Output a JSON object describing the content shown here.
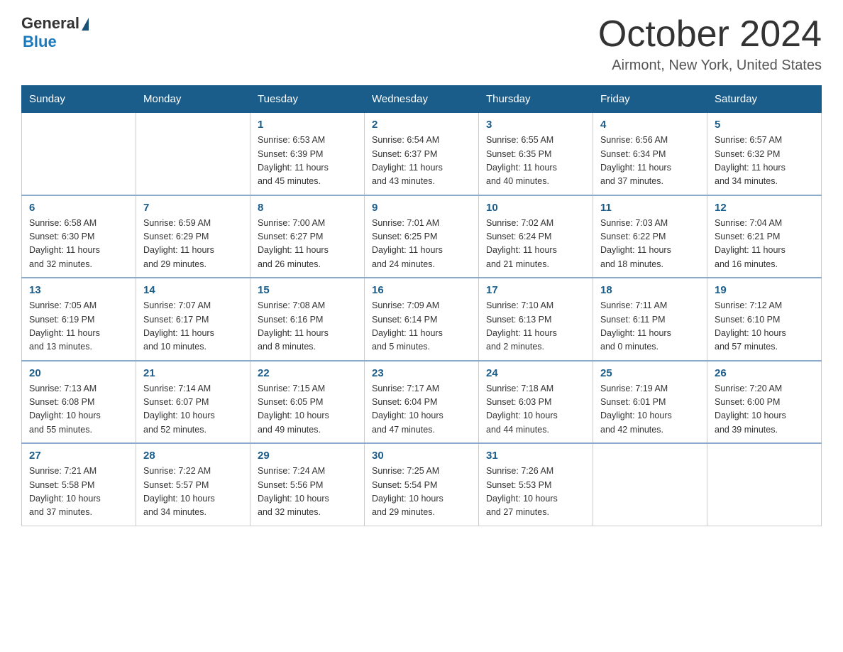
{
  "header": {
    "logo_general": "General",
    "logo_blue": "Blue",
    "month_title": "October 2024",
    "location": "Airmont, New York, United States"
  },
  "weekdays": [
    "Sunday",
    "Monday",
    "Tuesday",
    "Wednesday",
    "Thursday",
    "Friday",
    "Saturday"
  ],
  "weeks": [
    [
      {
        "day": "",
        "info": ""
      },
      {
        "day": "",
        "info": ""
      },
      {
        "day": "1",
        "info": "Sunrise: 6:53 AM\nSunset: 6:39 PM\nDaylight: 11 hours\nand 45 minutes."
      },
      {
        "day": "2",
        "info": "Sunrise: 6:54 AM\nSunset: 6:37 PM\nDaylight: 11 hours\nand 43 minutes."
      },
      {
        "day": "3",
        "info": "Sunrise: 6:55 AM\nSunset: 6:35 PM\nDaylight: 11 hours\nand 40 minutes."
      },
      {
        "day": "4",
        "info": "Sunrise: 6:56 AM\nSunset: 6:34 PM\nDaylight: 11 hours\nand 37 minutes."
      },
      {
        "day": "5",
        "info": "Sunrise: 6:57 AM\nSunset: 6:32 PM\nDaylight: 11 hours\nand 34 minutes."
      }
    ],
    [
      {
        "day": "6",
        "info": "Sunrise: 6:58 AM\nSunset: 6:30 PM\nDaylight: 11 hours\nand 32 minutes."
      },
      {
        "day": "7",
        "info": "Sunrise: 6:59 AM\nSunset: 6:29 PM\nDaylight: 11 hours\nand 29 minutes."
      },
      {
        "day": "8",
        "info": "Sunrise: 7:00 AM\nSunset: 6:27 PM\nDaylight: 11 hours\nand 26 minutes."
      },
      {
        "day": "9",
        "info": "Sunrise: 7:01 AM\nSunset: 6:25 PM\nDaylight: 11 hours\nand 24 minutes."
      },
      {
        "day": "10",
        "info": "Sunrise: 7:02 AM\nSunset: 6:24 PM\nDaylight: 11 hours\nand 21 minutes."
      },
      {
        "day": "11",
        "info": "Sunrise: 7:03 AM\nSunset: 6:22 PM\nDaylight: 11 hours\nand 18 minutes."
      },
      {
        "day": "12",
        "info": "Sunrise: 7:04 AM\nSunset: 6:21 PM\nDaylight: 11 hours\nand 16 minutes."
      }
    ],
    [
      {
        "day": "13",
        "info": "Sunrise: 7:05 AM\nSunset: 6:19 PM\nDaylight: 11 hours\nand 13 minutes."
      },
      {
        "day": "14",
        "info": "Sunrise: 7:07 AM\nSunset: 6:17 PM\nDaylight: 11 hours\nand 10 minutes."
      },
      {
        "day": "15",
        "info": "Sunrise: 7:08 AM\nSunset: 6:16 PM\nDaylight: 11 hours\nand 8 minutes."
      },
      {
        "day": "16",
        "info": "Sunrise: 7:09 AM\nSunset: 6:14 PM\nDaylight: 11 hours\nand 5 minutes."
      },
      {
        "day": "17",
        "info": "Sunrise: 7:10 AM\nSunset: 6:13 PM\nDaylight: 11 hours\nand 2 minutes."
      },
      {
        "day": "18",
        "info": "Sunrise: 7:11 AM\nSunset: 6:11 PM\nDaylight: 11 hours\nand 0 minutes."
      },
      {
        "day": "19",
        "info": "Sunrise: 7:12 AM\nSunset: 6:10 PM\nDaylight: 10 hours\nand 57 minutes."
      }
    ],
    [
      {
        "day": "20",
        "info": "Sunrise: 7:13 AM\nSunset: 6:08 PM\nDaylight: 10 hours\nand 55 minutes."
      },
      {
        "day": "21",
        "info": "Sunrise: 7:14 AM\nSunset: 6:07 PM\nDaylight: 10 hours\nand 52 minutes."
      },
      {
        "day": "22",
        "info": "Sunrise: 7:15 AM\nSunset: 6:05 PM\nDaylight: 10 hours\nand 49 minutes."
      },
      {
        "day": "23",
        "info": "Sunrise: 7:17 AM\nSunset: 6:04 PM\nDaylight: 10 hours\nand 47 minutes."
      },
      {
        "day": "24",
        "info": "Sunrise: 7:18 AM\nSunset: 6:03 PM\nDaylight: 10 hours\nand 44 minutes."
      },
      {
        "day": "25",
        "info": "Sunrise: 7:19 AM\nSunset: 6:01 PM\nDaylight: 10 hours\nand 42 minutes."
      },
      {
        "day": "26",
        "info": "Sunrise: 7:20 AM\nSunset: 6:00 PM\nDaylight: 10 hours\nand 39 minutes."
      }
    ],
    [
      {
        "day": "27",
        "info": "Sunrise: 7:21 AM\nSunset: 5:58 PM\nDaylight: 10 hours\nand 37 minutes."
      },
      {
        "day": "28",
        "info": "Sunrise: 7:22 AM\nSunset: 5:57 PM\nDaylight: 10 hours\nand 34 minutes."
      },
      {
        "day": "29",
        "info": "Sunrise: 7:24 AM\nSunset: 5:56 PM\nDaylight: 10 hours\nand 32 minutes."
      },
      {
        "day": "30",
        "info": "Sunrise: 7:25 AM\nSunset: 5:54 PM\nDaylight: 10 hours\nand 29 minutes."
      },
      {
        "day": "31",
        "info": "Sunrise: 7:26 AM\nSunset: 5:53 PM\nDaylight: 10 hours\nand 27 minutes."
      },
      {
        "day": "",
        "info": ""
      },
      {
        "day": "",
        "info": ""
      }
    ]
  ]
}
